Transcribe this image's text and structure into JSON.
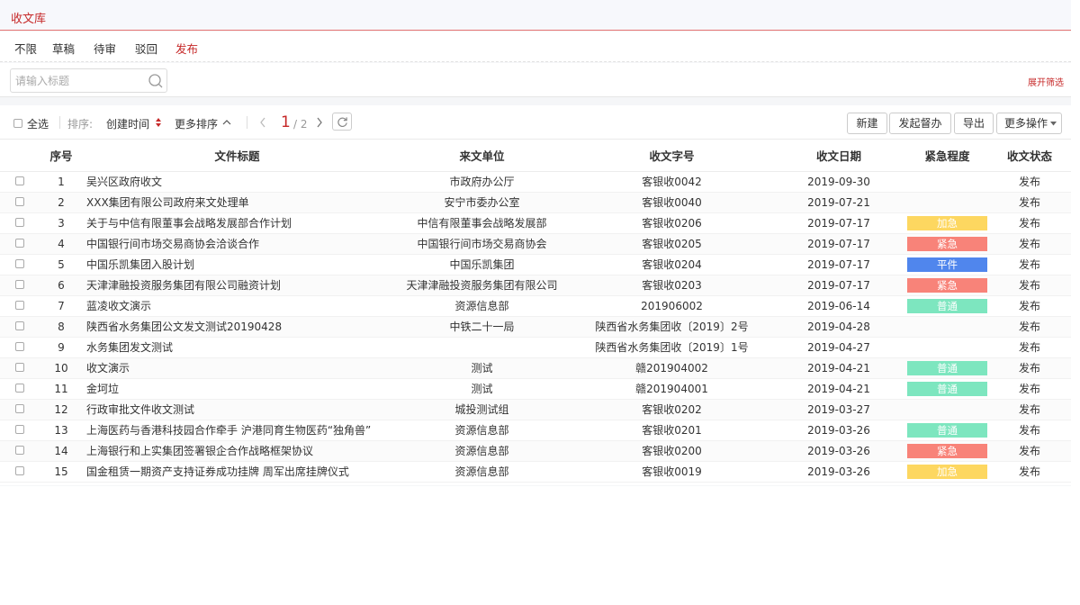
{
  "app": {
    "title": "收文库"
  },
  "filter_tabs": [
    {
      "label": "不限",
      "active": false
    },
    {
      "label": "草稿",
      "active": false
    },
    {
      "label": "待审",
      "active": false
    },
    {
      "label": "驳回",
      "active": false
    },
    {
      "label": "发布",
      "active": true
    }
  ],
  "search": {
    "placeholder": "请输入标题",
    "value": "",
    "icon": "search-icon"
  },
  "expand_filter": "展开筛选",
  "toolbar": {
    "select_all": "全选",
    "sort_label": "排序:",
    "sort_field": "创建时间",
    "more_sort": "更多排序",
    "page_current": "1",
    "page_total": "/ 2",
    "buttons": {
      "new": "新建",
      "urge": "发起督办",
      "export": "导出",
      "more": "更多操作"
    }
  },
  "table": {
    "columns": [
      "序号",
      "文件标题",
      "来文单位",
      "收文字号",
      "收文日期",
      "紧急程度",
      "收文状态"
    ],
    "rows": [
      {
        "no": "1",
        "title": "吴兴区政府收文",
        "unit": "市政府办公厅",
        "doc_no": "客银收0042",
        "date": "2019-09-30",
        "urgency": "",
        "status": "发布"
      },
      {
        "no": "2",
        "title": "XXX集团有限公司政府来文处理单",
        "unit": "安宁市委办公室",
        "doc_no": "客银收0040",
        "date": "2019-07-21",
        "urgency": "",
        "status": "发布"
      },
      {
        "no": "3",
        "title": "关于与中信有限董事会战略发展部合作计划",
        "unit": "中信有限董事会战略发展部",
        "doc_no": "客银收0206",
        "date": "2019-07-17",
        "urgency": "加急",
        "status": "发布"
      },
      {
        "no": "4",
        "title": "中国银行间市场交易商协会洽谈合作",
        "unit": "中国银行间市场交易商协会",
        "doc_no": "客银收0205",
        "date": "2019-07-17",
        "urgency": "紧急",
        "status": "发布"
      },
      {
        "no": "5",
        "title": "中国乐凯集团入股计划",
        "unit": "中国乐凯集团",
        "doc_no": "客银收0204",
        "date": "2019-07-17",
        "urgency": "平件",
        "status": "发布"
      },
      {
        "no": "6",
        "title": "天津津融投资服务集团有限公司融资计划",
        "unit": "天津津融投资服务集团有限公司",
        "doc_no": "客银收0203",
        "date": "2019-07-17",
        "urgency": "紧急",
        "status": "发布"
      },
      {
        "no": "7",
        "title": "蓝凌收文演示",
        "unit": "资源信息部",
        "doc_no": "201906002",
        "date": "2019-06-14",
        "urgency": "普通",
        "status": "发布"
      },
      {
        "no": "8",
        "title": "陕西省水务集团公文发文测试20190428",
        "unit": "中铁二十一局",
        "doc_no": "陕西省水务集团收〔2019〕2号",
        "date": "2019-04-28",
        "urgency": "",
        "status": "发布"
      },
      {
        "no": "9",
        "title": "水务集团发文测试",
        "unit": "",
        "doc_no": "陕西省水务集团收〔2019〕1号",
        "date": "2019-04-27",
        "urgency": "",
        "status": "发布"
      },
      {
        "no": "10",
        "title": "收文演示",
        "unit": "测试",
        "doc_no": "赣201904002",
        "date": "2019-04-21",
        "urgency": "普通",
        "status": "发布"
      },
      {
        "no": "11",
        "title": "金坷垃",
        "unit": "测试",
        "doc_no": "赣201904001",
        "date": "2019-04-21",
        "urgency": "普通",
        "status": "发布"
      },
      {
        "no": "12",
        "title": "行政审批文件收文测试",
        "unit": "城投测试组",
        "doc_no": "客银收0202",
        "date": "2019-03-27",
        "urgency": "",
        "status": "发布"
      },
      {
        "no": "13",
        "title": "上海医药与香港科技园合作牵手 沪港同育生物医药“独角兽”",
        "unit": "资源信息部",
        "doc_no": "客银收0201",
        "date": "2019-03-26",
        "urgency": "普通",
        "status": "发布"
      },
      {
        "no": "14",
        "title": "上海银行和上实集团签署银企合作战略框架协议",
        "unit": "资源信息部",
        "doc_no": "客银收0200",
        "date": "2019-03-26",
        "urgency": "紧急",
        "status": "发布"
      },
      {
        "no": "15",
        "title": "国金租赁一期资产支持证券成功挂牌 周军出席挂牌仪式",
        "unit": "资源信息部",
        "doc_no": "客银收0019",
        "date": "2019-03-26",
        "urgency": "加急",
        "status": "发布"
      }
    ]
  },
  "colors": {
    "accent": "#c62828",
    "加急": "#fdd760",
    "紧急": "#f88379",
    "平件": "#5086ed",
    "普通": "#7de6bf"
  }
}
